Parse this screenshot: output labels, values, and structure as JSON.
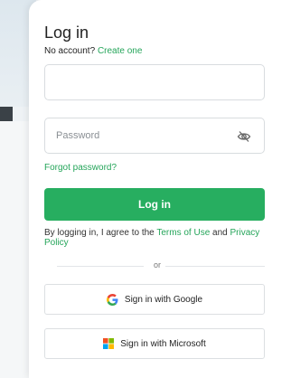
{
  "login": {
    "title": "Log in",
    "no_account_text": "No account?",
    "create_link": "Create one",
    "username_value": "",
    "password_placeholder": "Password",
    "forgot_password": "Forgot password?",
    "submit_label": "Log in",
    "terms_prefix": "By logging in, I agree to the",
    "terms_of_use": "Terms of Use",
    "terms_and": "and",
    "privacy_policy": "Privacy Policy",
    "divider_text": "or",
    "google_label": "Sign in with Google",
    "microsoft_label": "Sign in with Microsoft"
  },
  "colors": {
    "accent": "#27ae60",
    "link": "#25a55a"
  },
  "icons": {
    "password_toggle": "eye-off-icon",
    "google": "google-logo",
    "microsoft": "microsoft-logo"
  }
}
